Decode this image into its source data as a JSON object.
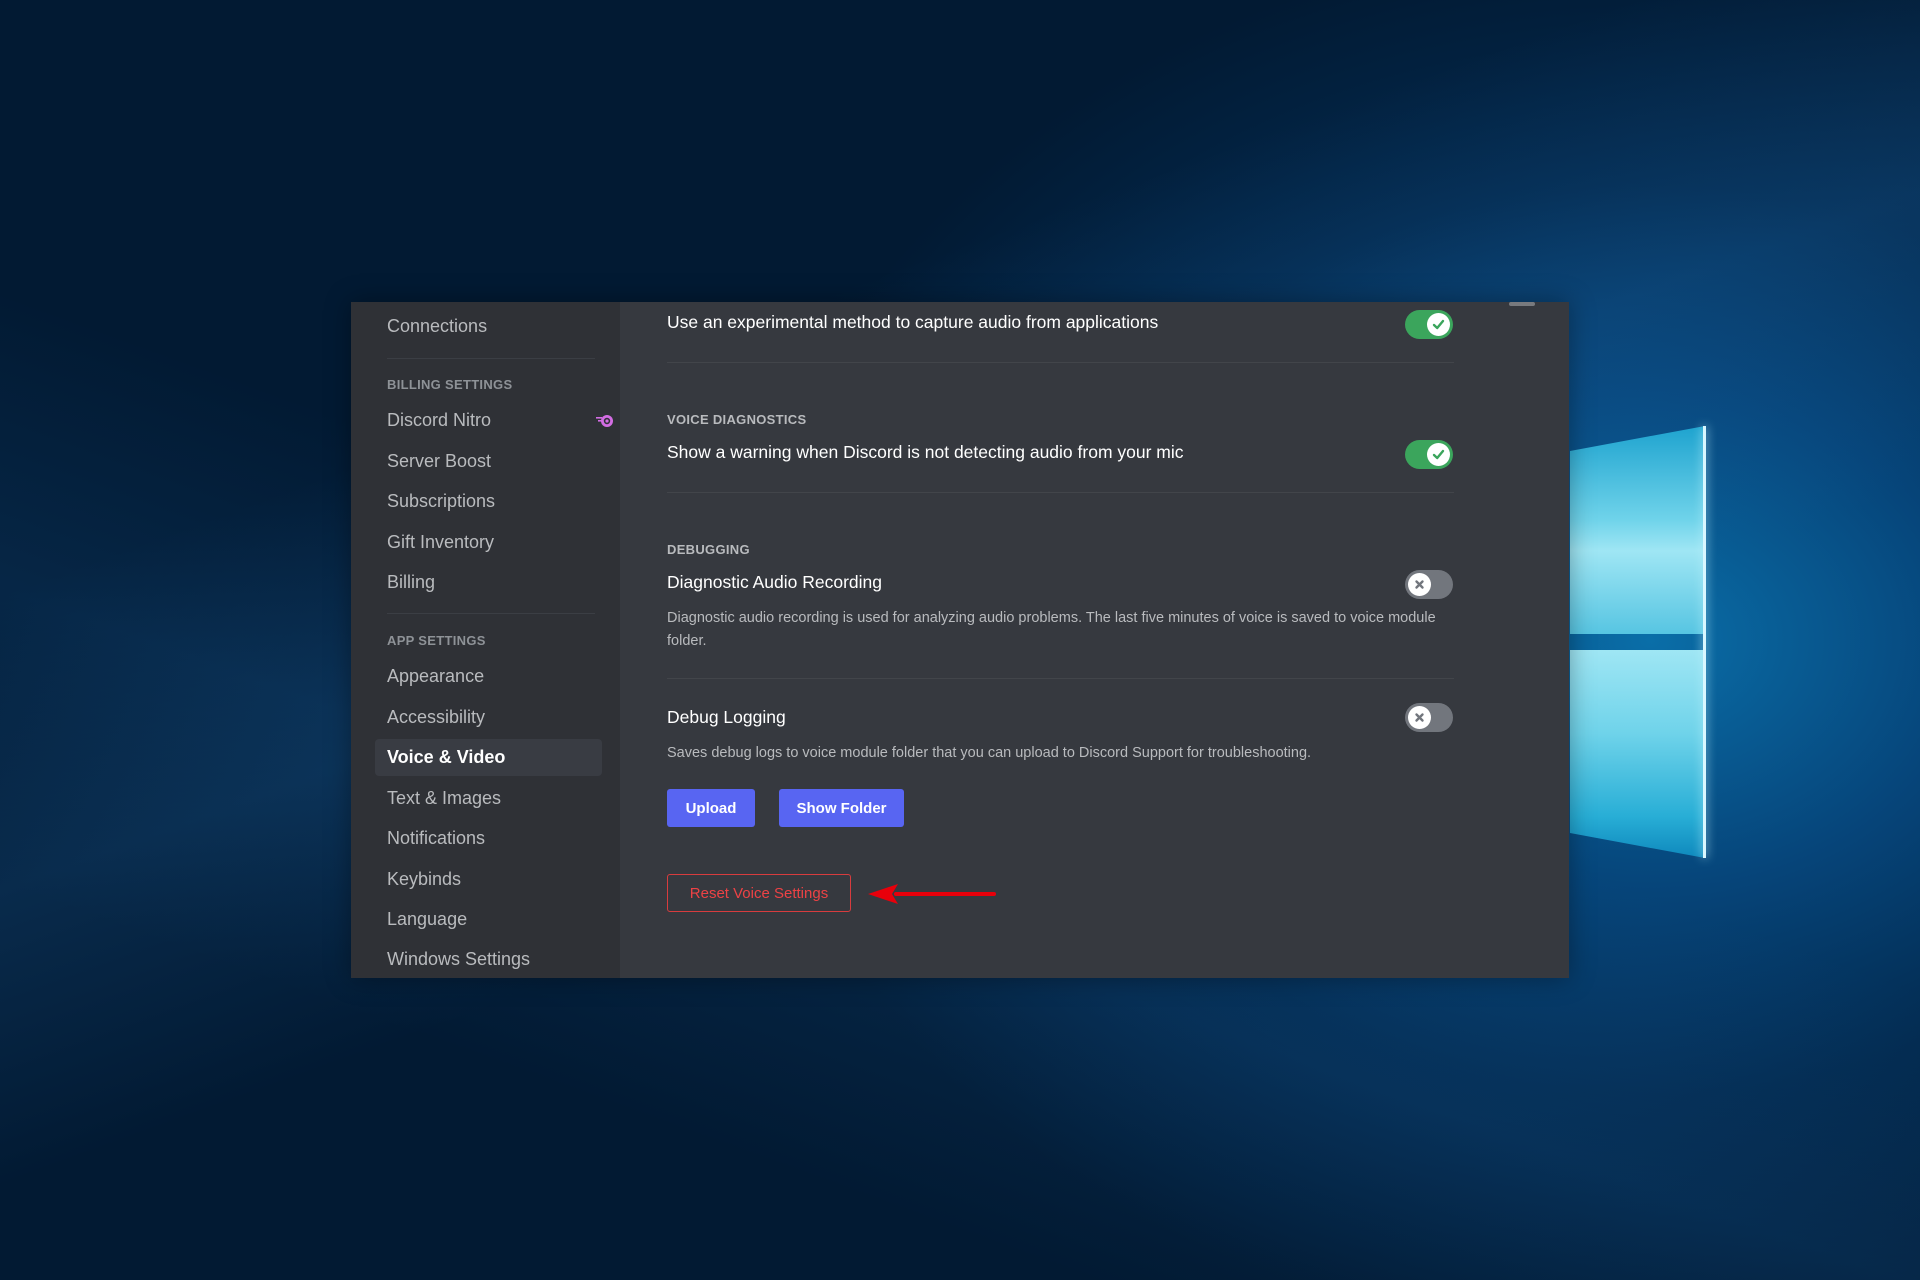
{
  "sidebar": {
    "items_top": [
      {
        "label": "Connections"
      }
    ],
    "billing_header": "BILLING SETTINGS",
    "billing_items": [
      {
        "label": "Discord Nitro",
        "icon": "nitro-icon"
      },
      {
        "label": "Server Boost"
      },
      {
        "label": "Subscriptions"
      },
      {
        "label": "Gift Inventory"
      },
      {
        "label": "Billing"
      }
    ],
    "app_header": "APP SETTINGS",
    "app_items": [
      {
        "label": "Appearance"
      },
      {
        "label": "Accessibility"
      },
      {
        "label": "Voice & Video",
        "active": true
      },
      {
        "label": "Text & Images"
      },
      {
        "label": "Notifications"
      },
      {
        "label": "Keybinds"
      },
      {
        "label": "Language"
      },
      {
        "label": "Windows Settings"
      }
    ]
  },
  "content": {
    "experimental_capture": {
      "title": "Use an experimental method to capture audio from applications",
      "enabled": true
    },
    "voice_diagnostics": {
      "header": "VOICE DIAGNOSTICS",
      "title": "Show a warning when Discord is not detecting audio from your mic",
      "enabled": true
    },
    "debugging": {
      "header": "DEBUGGING",
      "diagnostic_recording": {
        "title": "Diagnostic Audio Recording",
        "description": "Diagnostic audio recording is used for analyzing audio problems. The last five minutes of voice is saved to voice module folder.",
        "enabled": false
      },
      "debug_logging": {
        "title": "Debug Logging",
        "description": "Saves debug logs to voice module folder that you can upload to Discord Support for troubleshooting.",
        "enabled": false
      },
      "upload_label": "Upload",
      "show_folder_label": "Show Folder"
    },
    "reset_label": "Reset Voice Settings"
  },
  "colors": {
    "accent": "#5865f2",
    "toggle_on": "#3ba55c",
    "toggle_off": "#72767d",
    "danger": "#ed4245",
    "annotation_arrow": "#e8000b"
  }
}
